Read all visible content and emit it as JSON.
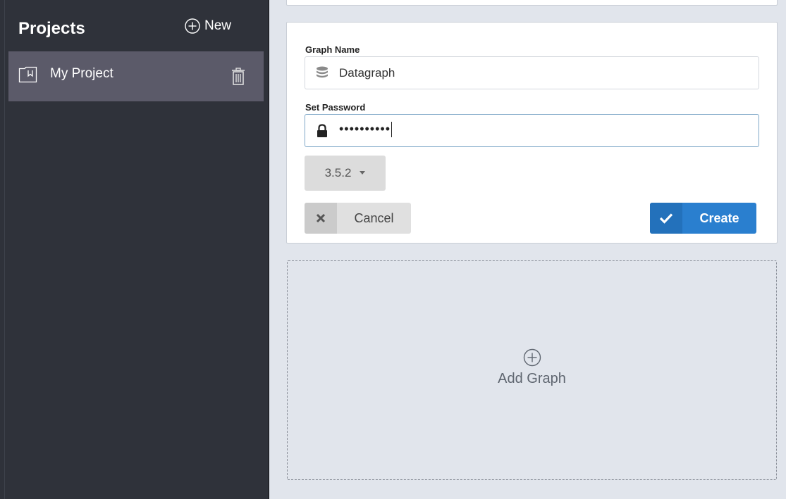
{
  "sidebar": {
    "title": "Projects",
    "new_label": "New",
    "projects": [
      {
        "name": "My Project",
        "icon": "folder-icon",
        "delete_icon": "trash-icon"
      }
    ]
  },
  "form": {
    "graph_name_label": "Graph Name",
    "graph_name_value": "Datagraph",
    "graph_name_icon": "database-icon",
    "password_label": "Set Password",
    "password_mask": "••••••••••",
    "password_icon": "lock-icon",
    "version": "3.5.2",
    "cancel_label": "Cancel",
    "create_label": "Create"
  },
  "add_graph": {
    "label": "Add Graph",
    "icon": "plus-circle-icon"
  },
  "colors": {
    "sidebar_bg": "#2f323a",
    "selected_item_bg": "#5b5a69",
    "primary": "#2a7fcf",
    "page_bg": "#e1e5ec"
  }
}
